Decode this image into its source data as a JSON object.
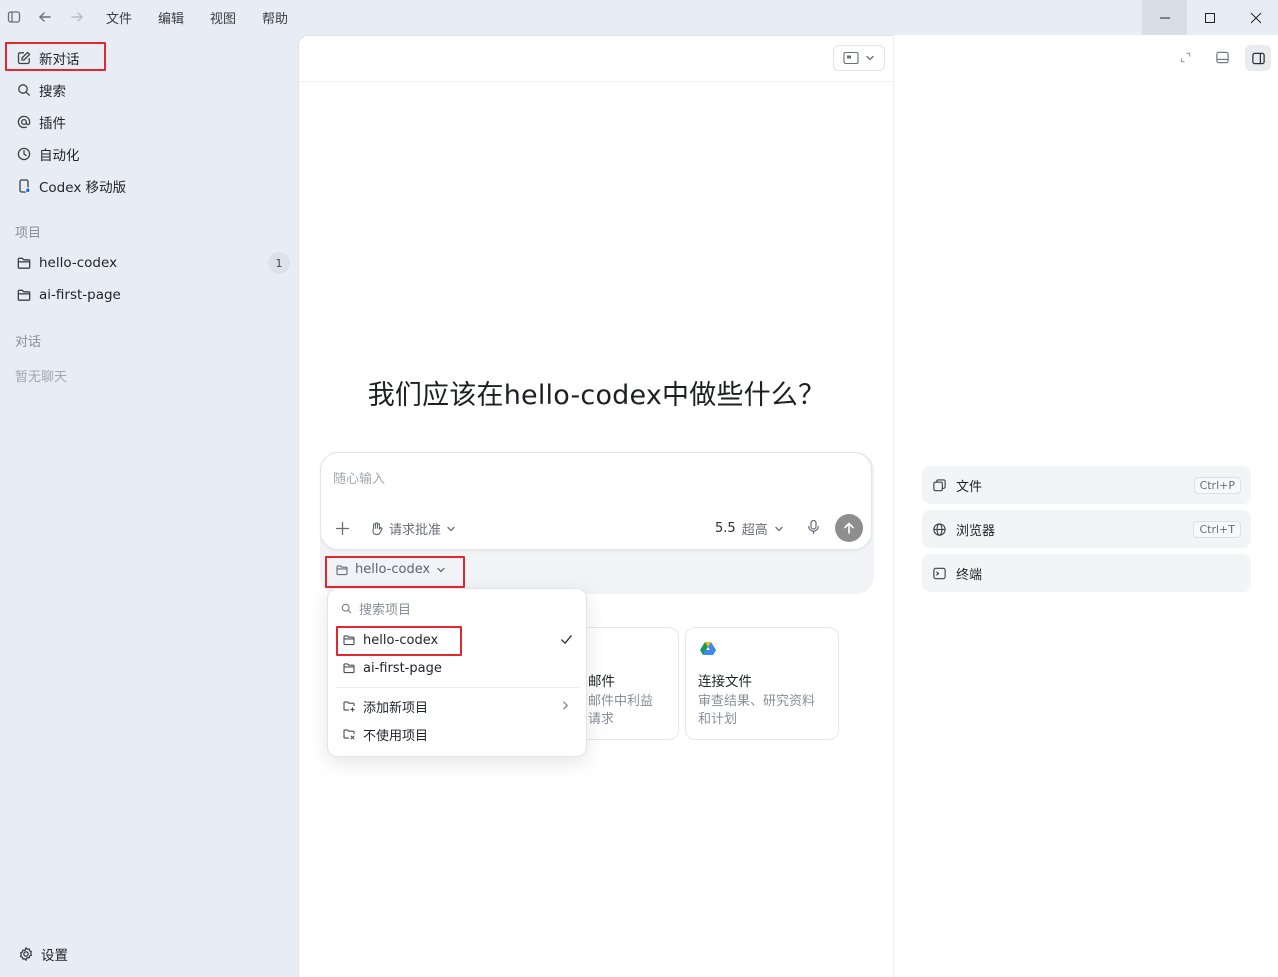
{
  "menu": {
    "items": [
      "文件",
      "编辑",
      "视图",
      "帮助"
    ]
  },
  "sidebar": {
    "items": [
      {
        "label": "新对话",
        "icon": "edit-icon"
      },
      {
        "label": "搜索",
        "icon": "search-icon"
      },
      {
        "label": "插件",
        "icon": "at-icon"
      },
      {
        "label": "自动化",
        "icon": "clock-icon"
      },
      {
        "label": "Codex 移动版",
        "icon": "mobile-icon"
      }
    ],
    "projects_heading": "项目",
    "projects": [
      {
        "label": "hello-codex",
        "badge": "1"
      },
      {
        "label": "ai-first-page"
      }
    ],
    "chats_heading": "对话",
    "chats_empty": "暂无聊天",
    "settings_label": "设置"
  },
  "main": {
    "hero_title": "我们应该在hello-codex中做些什么？",
    "composer": {
      "placeholder": "随心输入",
      "approval_label": "请求批准",
      "model": "5.5",
      "effort": "超高"
    },
    "project_selector": "hello-codex",
    "dropdown": {
      "search_placeholder": "搜索项目",
      "items": [
        "hello-codex",
        "ai-first-page"
      ],
      "add_project": "添加新项目",
      "no_project": "不使用项目"
    },
    "cards": [
      {
        "title": "邮件",
        "desc_line1": "邮件中利益",
        "desc_line2": "请求"
      },
      {
        "title": "连接文件",
        "desc_line1": "审查结果、研究资料",
        "desc_line2": "和计划"
      }
    ]
  },
  "right_panel": {
    "rows": [
      {
        "label": "文件",
        "shortcut": "Ctrl+P"
      },
      {
        "label": "浏览器",
        "shortcut": "Ctrl+T"
      },
      {
        "label": "终端"
      }
    ]
  },
  "colors": {
    "accent_red": "#e0282e",
    "sidebar_bg": "#e8edf5",
    "send_button": "#8e8e8e"
  }
}
